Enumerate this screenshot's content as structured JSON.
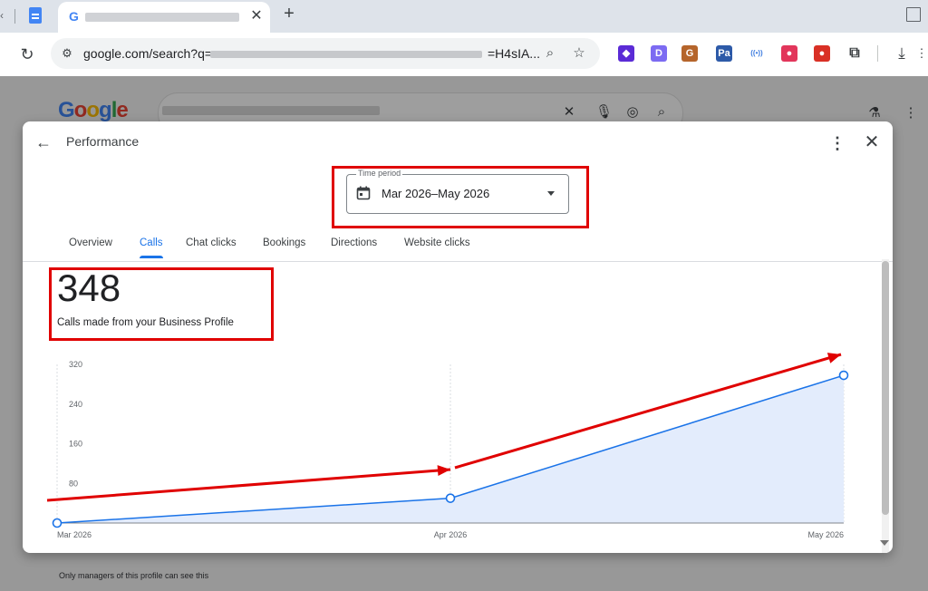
{
  "browser": {
    "tab_title": "",
    "tab_favicon": "G",
    "new_tab_label": "+",
    "url_prefix": "google.com/search?q=",
    "url_suffix": "=H4sIA...",
    "extensions": [
      {
        "name": "diamond-extension-icon",
        "glyph": "◆",
        "color": "#5b2bd6"
      },
      {
        "name": "d-extension-icon",
        "glyph": "D",
        "color": "#7c6bf2"
      },
      {
        "name": "g-extension-icon",
        "glyph": "G",
        "color": "#b5652b"
      },
      {
        "name": "patreon-extension-icon",
        "glyph": "Pa",
        "color": "#2d5aa8"
      },
      {
        "name": "broadcast-extension-icon",
        "glyph": "((•))",
        "color": "#3f7de0"
      },
      {
        "name": "color-wheel-extension-icon",
        "glyph": "●",
        "color": "#e2365b"
      },
      {
        "name": "pin-extension-icon",
        "glyph": "●",
        "color": "#d93025"
      },
      {
        "name": "puzzle-extension-icon",
        "glyph": "⧉",
        "color": "#3c4043"
      }
    ]
  },
  "page": {
    "logo": "Google",
    "logo_colors": [
      "#4285f4",
      "#ea4335",
      "#fbbc05",
      "#4285f4",
      "#34a853",
      "#ea4335"
    ],
    "footer_note": "Only managers of this profile can see this"
  },
  "dialog": {
    "title": "Performance",
    "time_period": {
      "label": "Time period",
      "value": "Mar 2026–May 2026"
    },
    "tabs": [
      {
        "label": "Overview",
        "active": false
      },
      {
        "label": "Calls",
        "active": true
      },
      {
        "label": "Chat clicks",
        "active": false
      },
      {
        "label": "Bookings",
        "active": false
      },
      {
        "label": "Directions",
        "active": false
      },
      {
        "label": "Website clicks",
        "active": false
      }
    ],
    "metric": {
      "value": "348",
      "caption": "Calls made from your Business Profile"
    }
  },
  "chart_data": {
    "type": "area",
    "title": "",
    "xlabel": "",
    "ylabel": "",
    "categories": [
      "Mar 2026",
      "Apr 2026",
      "May 2026"
    ],
    "series": [
      {
        "values": [
          0,
          50,
          298
        ],
        "color": "#1a73e8",
        "fill": "#e3ecfc"
      }
    ],
    "yticks": [
      80,
      160,
      240,
      320
    ],
    "ylim": [
      0,
      320
    ],
    "grid": "vertical dashed at categories"
  },
  "annotations": {
    "color": "#e00000"
  }
}
